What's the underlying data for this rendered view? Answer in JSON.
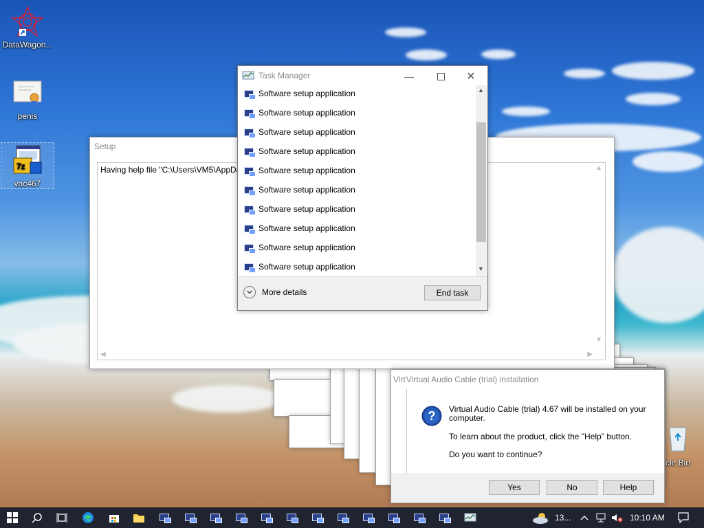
{
  "desktop": {
    "icons": [
      {
        "label": "DataWagon...",
        "icon": "starburst-shortcut-icon"
      },
      {
        "label": "penis",
        "icon": "certificate-icon"
      },
      {
        "label": "vac467",
        "icon": "installer-7z-icon"
      },
      {
        "label": "ycle Bin",
        "icon": "recycle-bin-icon"
      }
    ]
  },
  "setup_window": {
    "title": "Setup",
    "text": "Having help file \"C:\\Users\\VM5\\AppData\\L"
  },
  "task_manager": {
    "title": "Task Manager",
    "items": [
      "Software setup application",
      "Software setup application",
      "Software setup application",
      "Software setup application",
      "Software setup application",
      "Software setup application",
      "Software setup application",
      "Software setup application",
      "Software setup application",
      "Software setup application"
    ],
    "more_details": "More details",
    "end_task": "End task"
  },
  "vac_dialog": {
    "title_clipped": "Virt",
    "title": "Virtual Audio Cable (trial) installation",
    "line1": "Virtual Audio Cable (trial) 4.67 will be installed on your computer.",
    "line2": "To learn about the product, click the \"Help\" button.",
    "line3": "Do you want to continue?",
    "yes": "Yes",
    "no": "No",
    "help": "Help"
  },
  "taskbar": {
    "weather_temp": "13...",
    "clock": "10:10 AM",
    "running_app_count": 12
  },
  "colors": {
    "taskbar_bg": "#1f2430",
    "button_bg": "#e1e1e1",
    "question_icon": "#1f4fa8"
  }
}
